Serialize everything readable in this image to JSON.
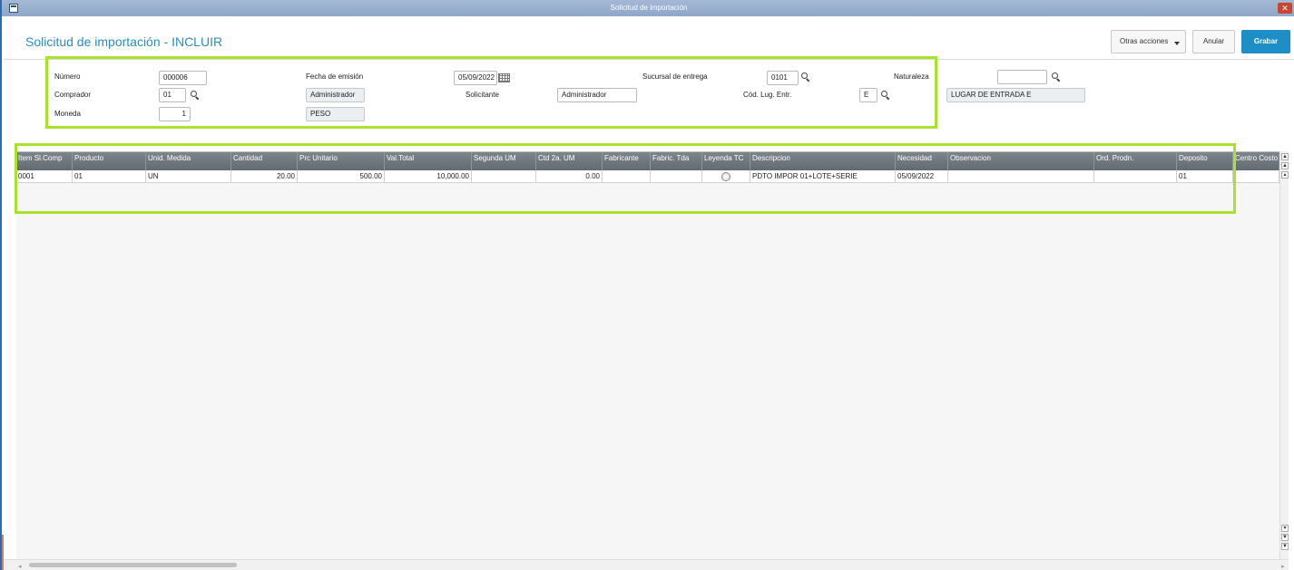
{
  "window": {
    "title": "Solicitud de importación",
    "close_glyph": "✕"
  },
  "header": {
    "page_title": "Solicitud de importación - INCLUIR",
    "buttons": {
      "otras_acciones": "Otras acciones",
      "anular": "Anular",
      "grabar": "Grabar"
    }
  },
  "form": {
    "numero": {
      "label": "Número",
      "value": "000006"
    },
    "fecha_emision": {
      "label": "Fecha de emisión",
      "value": "05/09/2022"
    },
    "sucursal_entrega": {
      "label": "Sucursal de entrega",
      "value": "0101"
    },
    "naturaleza": {
      "label": "Naturaleza",
      "value": ""
    },
    "comprador": {
      "label": "Comprador",
      "value": "01",
      "name": "Administrador"
    },
    "solicitante": {
      "label": "Solicitante",
      "value": "Administrador"
    },
    "cod_lug_entr": {
      "label": "Cód. Lug. Entr.",
      "value": "E",
      "desc": "LUGAR DE ENTRADA E"
    },
    "moneda": {
      "label": "Moneda",
      "value": "1",
      "name": "PESO"
    }
  },
  "grid": {
    "columns": [
      "Item Sl.Comp",
      "Producto",
      "Unid. Medida",
      "Cantidad",
      "Prc Unitario",
      "Val.Total",
      "Segunda UM",
      "Ctd 2a. UM",
      "Fabricante",
      "Fabric. Tda",
      "Leyenda TC",
      "Descripcion",
      "Necesidad",
      "Observacion",
      "Ord. Prodn.",
      "Deposito",
      "Centro Costo"
    ],
    "rows": [
      {
        "item": "0001",
        "producto": "01",
        "unid_medida": "UN",
        "cantidad": "20.00",
        "prc_unitario": "500.00",
        "val_total": "10,000.00",
        "segunda_um": "",
        "ctd_2a_um": "0.00",
        "fabricante": "",
        "fabric_tda": "",
        "leyenda_tc": "",
        "descripcion": "PDTO IMPOR 01+LOTE+SERIE",
        "necesidad": "05/09/2022",
        "observacion": "",
        "ord_prodn": "",
        "deposito": "01",
        "centro_costo": ""
      }
    ]
  },
  "icons": [
    "window-icon",
    "search-icon",
    "calendar-icon",
    "chevron-down-icon",
    "close-icon",
    "radio-icon"
  ],
  "colors": {
    "accent": "#2a8fbd",
    "primary_button": "#1e8fc6",
    "highlight": "#a9e22b",
    "grid_header": "#6b737a"
  }
}
